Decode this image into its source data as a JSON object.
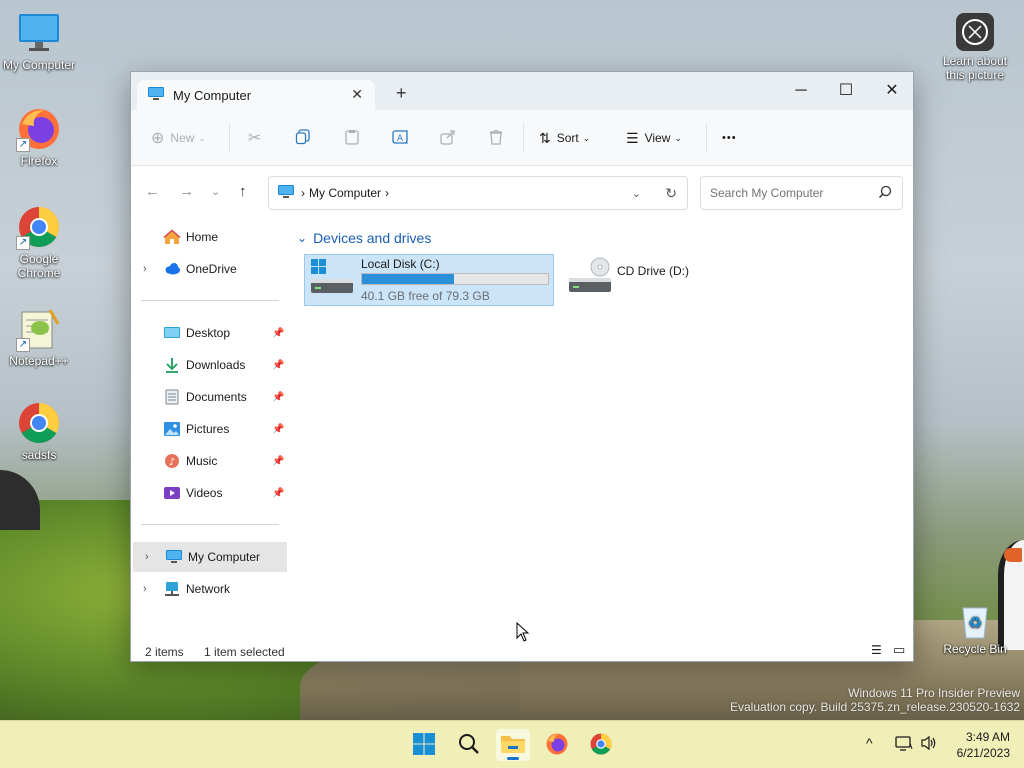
{
  "desktop": {
    "icons": [
      {
        "label": "My Computer"
      },
      {
        "label": "Firefox"
      },
      {
        "label": "Google Chrome"
      },
      {
        "label": "Notepad++"
      },
      {
        "label": "sadsfs"
      },
      {
        "label": "Learn about this picture"
      },
      {
        "label": "Recycle Bin"
      }
    ],
    "watermark_line1": "Windows 11 Pro Insider Preview",
    "watermark_line2": "Evaluation copy. Build 25375.zn_release.230520-1632"
  },
  "window": {
    "tab_title": "My Computer",
    "toolbar": {
      "new_label": "New",
      "sort_label": "Sort",
      "view_label": "View",
      "more_label": "•••"
    },
    "address": {
      "crumb": "My Computer"
    },
    "search": {
      "placeholder": "Search My Computer"
    },
    "sidebar": {
      "items": [
        {
          "label": "Home"
        },
        {
          "label": "OneDrive"
        },
        {
          "label": "Desktop"
        },
        {
          "label": "Downloads"
        },
        {
          "label": "Documents"
        },
        {
          "label": "Pictures"
        },
        {
          "label": "Music"
        },
        {
          "label": "Videos"
        },
        {
          "label": "My Computer"
        },
        {
          "label": "Network"
        }
      ]
    },
    "content": {
      "group_header": "Devices and drives",
      "drives": [
        {
          "name": "Local Disk (C:)",
          "info": "40.1 GB free of 79.3 GB",
          "used_fraction": 0.494
        },
        {
          "name": "CD Drive (D:)"
        }
      ]
    },
    "status": {
      "items": "2 items",
      "selected": "1 item selected"
    }
  },
  "taskbar": {
    "time": "3:49 AM",
    "date": "6/21/2023"
  },
  "colors": {
    "accent": "#1a5fb4",
    "drive_fill": "#2b90d9",
    "selection": "#cce4f7",
    "taskbar": "#f0efb8"
  }
}
